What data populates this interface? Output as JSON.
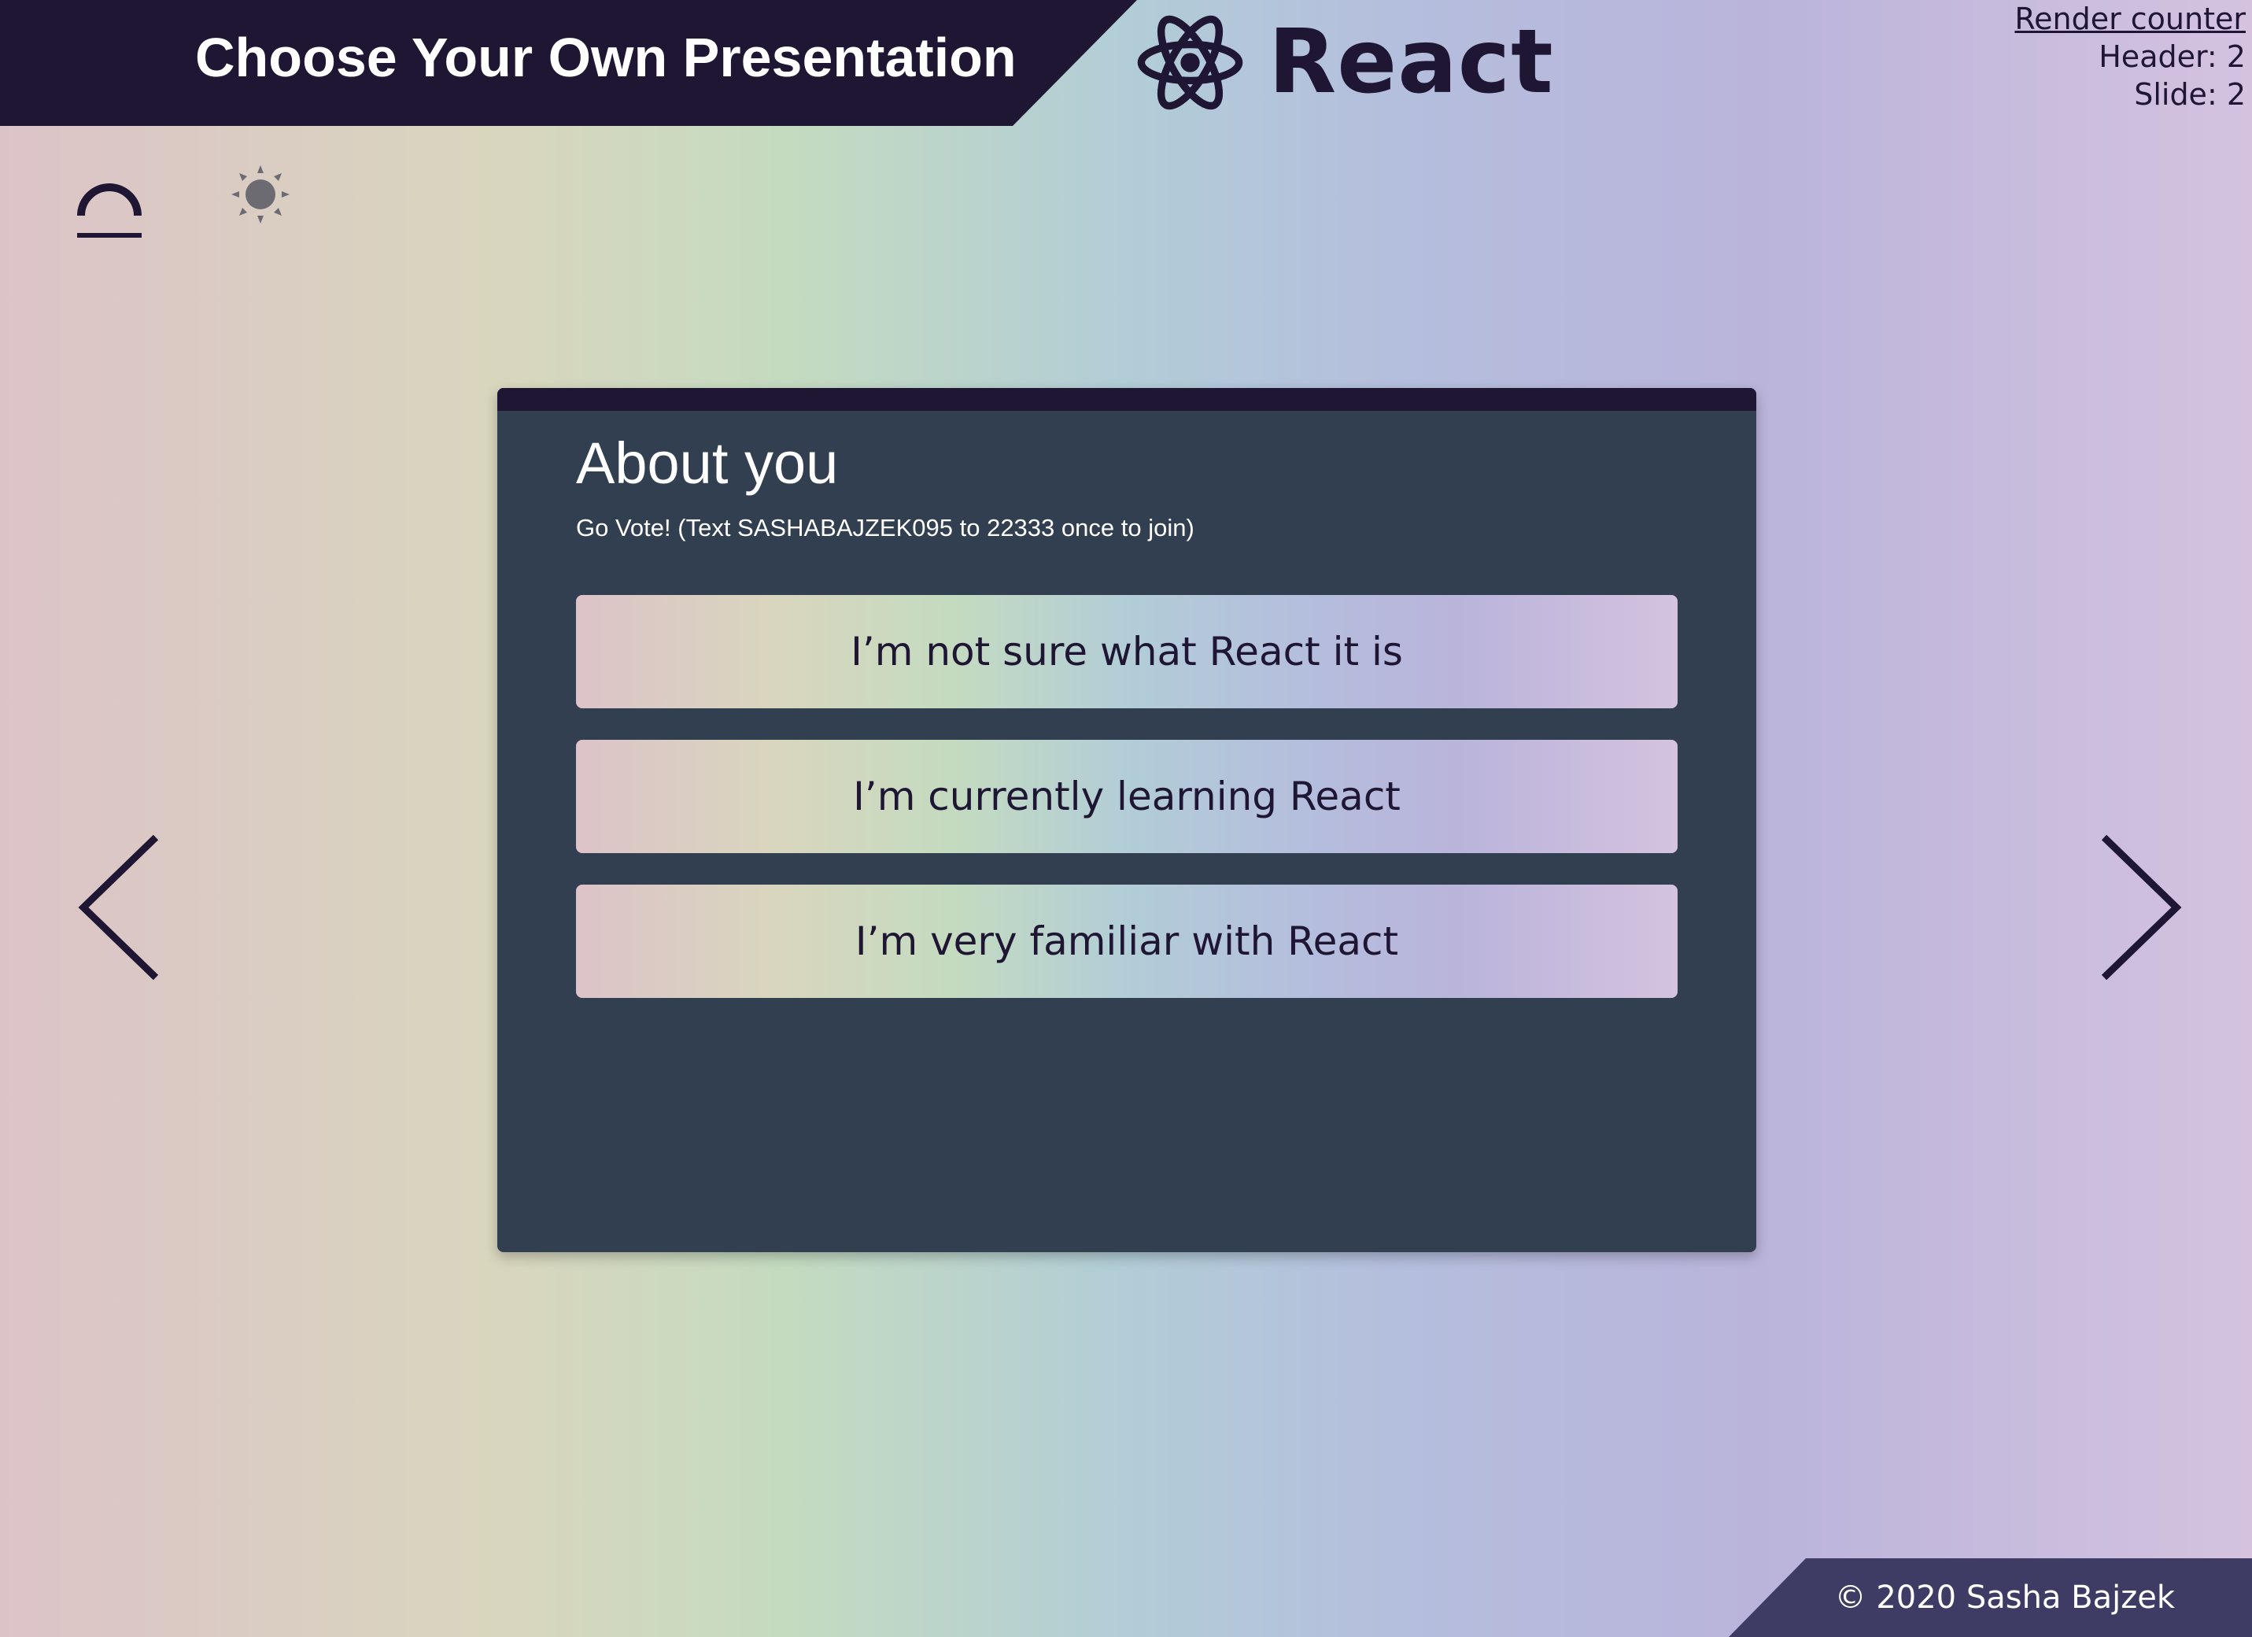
{
  "header": {
    "title": "Choose Your Own Presentation",
    "brand_icon": "react-atom-icon",
    "brand_name": "React"
  },
  "render_counter": {
    "link_label": "Render counter",
    "header_line": "Header: 2",
    "slide_line": "Slide: 2"
  },
  "theme_switcher": {
    "options": [
      {
        "icon": "sunrise-icon",
        "selected": true
      },
      {
        "icon": "moon-icon",
        "selected": false
      },
      {
        "icon": "sun-icon",
        "selected": false
      }
    ]
  },
  "slide": {
    "title": "About you",
    "subtitle": "Go Vote! (Text SASHABAJZEK095 to 22333 once to join)",
    "options": [
      {
        "label": "I’m not sure what React it is"
      },
      {
        "label": "I’m currently learning React"
      },
      {
        "label": "I’m very familiar with React"
      }
    ]
  },
  "navigation": {
    "prev_icon": "chevron-left-icon",
    "next_icon": "chevron-right-icon"
  },
  "footer": {
    "text": "© 2020 Sasha Bajzek"
  },
  "colors": {
    "dark_primary": "#1e1633",
    "panel_bg": "#323f50",
    "footer_bg": "#3e3c64",
    "icon_gray": "#6d6b72"
  }
}
